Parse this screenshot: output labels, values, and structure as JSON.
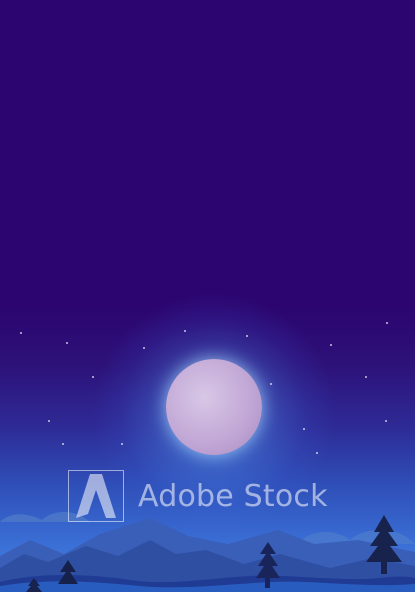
{
  "watermark": {
    "text": "Adobe Stock",
    "icon": "adobe-logo-icon"
  }
}
